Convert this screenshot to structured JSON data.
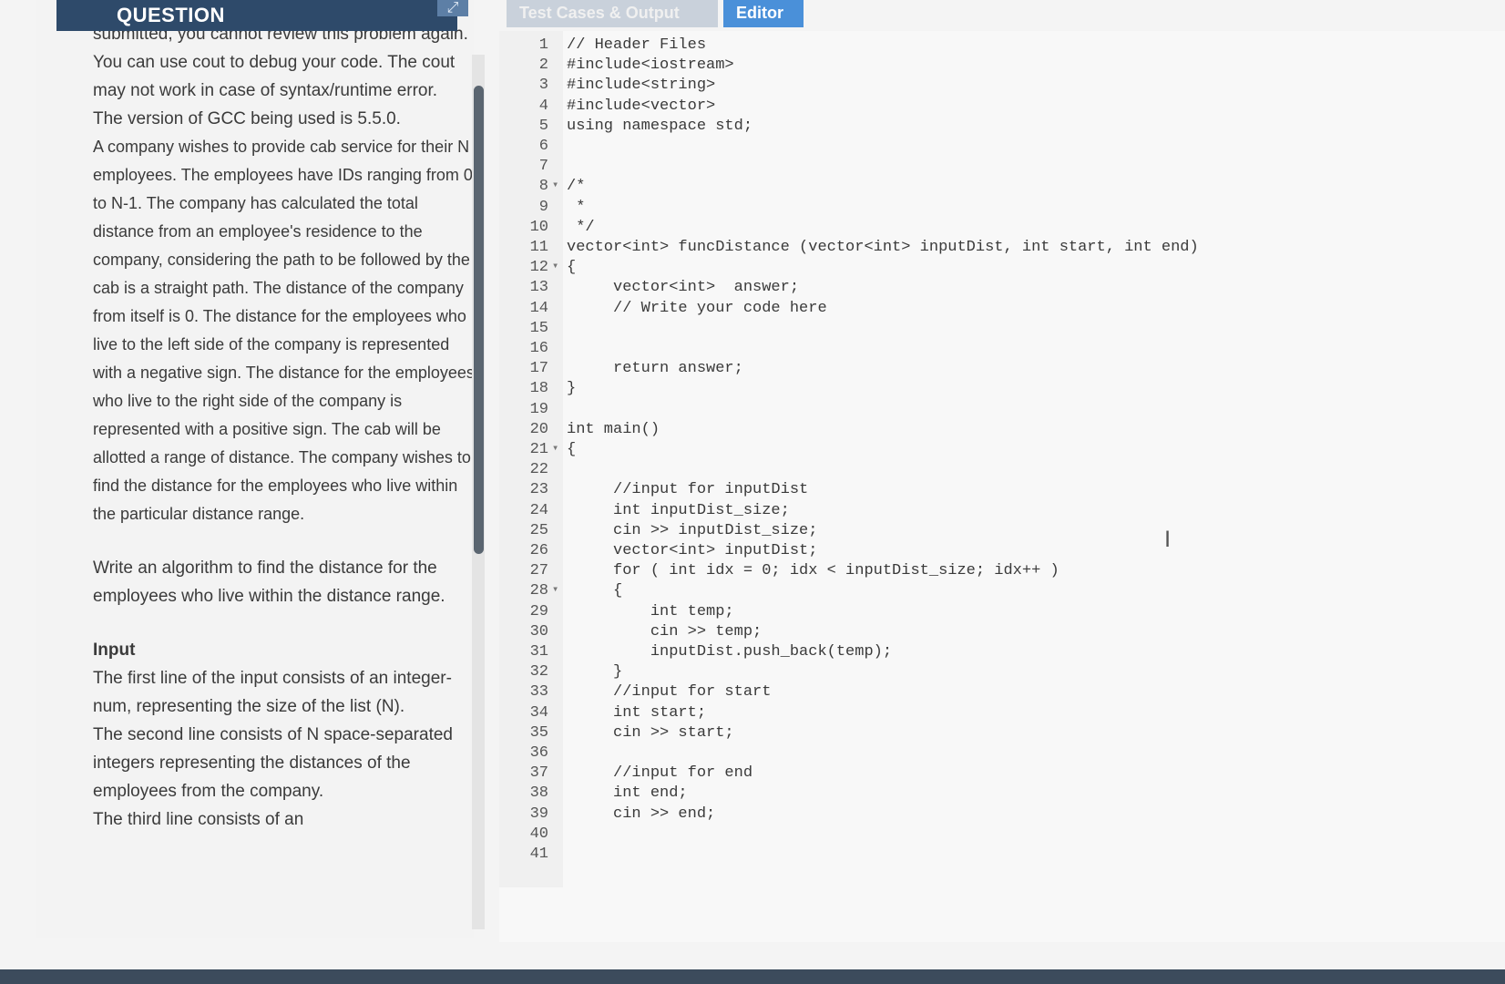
{
  "tabs": {
    "question": "QUESTION",
    "test_cases": "Test Cases & Output",
    "editor": "Editor"
  },
  "question": {
    "paragraphs": [
      "submitted, you cannot review this problem again. You can use cout to debug your code. The cout may not work in case of syntax/runtime error.",
      "The version of GCC being used is 5.5.0.",
      "A company wishes to provide cab service for their N employees. The employees have IDs ranging from 0 to N-1. The company has calculated the total distance from an employee's residence to the company, considering the path to be followed by the cab is a straight path. The distance of the company from itself is 0. The distance for the employees who live to the left side of the company is represented with a negative sign. The distance for the employees who live to the right side of the company is represented with a positive sign. The cab will be allotted a range of distance. The company wishes to find the distance for the employees who live within the particular distance range.",
      "Write an algorithm to find the distance for the employees who live within the distance range.",
      "Input",
      "The first line of the input consists of an integer- num, representing the size of the list (N).",
      "The second line consists of N space-separated integers representing the distances of the employees from the company.",
      "The third line consists of an"
    ]
  },
  "code_lines": [
    {
      "n": "1",
      "fold": "",
      "text": "// Header Files"
    },
    {
      "n": "2",
      "fold": "",
      "text": "#include<iostream>"
    },
    {
      "n": "3",
      "fold": "",
      "text": "#include<string>"
    },
    {
      "n": "4",
      "fold": "",
      "text": "#include<vector>"
    },
    {
      "n": "5",
      "fold": "",
      "text": "using namespace std;"
    },
    {
      "n": "6",
      "fold": "",
      "text": ""
    },
    {
      "n": "7",
      "fold": "",
      "text": ""
    },
    {
      "n": "8",
      "fold": "▾",
      "text": "/*"
    },
    {
      "n": "9",
      "fold": "",
      "text": " *"
    },
    {
      "n": "10",
      "fold": "",
      "text": " */"
    },
    {
      "n": "11",
      "fold": "",
      "text": "vector<int> funcDistance (vector<int> inputDist, int start, int end)"
    },
    {
      "n": "12",
      "fold": "▾",
      "text": "{"
    },
    {
      "n": "13",
      "fold": "",
      "text": "     vector<int>  answer;"
    },
    {
      "n": "14",
      "fold": "",
      "text": "     // Write your code here"
    },
    {
      "n": "15",
      "fold": "",
      "text": ""
    },
    {
      "n": "16",
      "fold": "",
      "text": ""
    },
    {
      "n": "17",
      "fold": "",
      "text": "     return answer;"
    },
    {
      "n": "18",
      "fold": "",
      "text": "}"
    },
    {
      "n": "19",
      "fold": "",
      "text": ""
    },
    {
      "n": "20",
      "fold": "",
      "text": "int main()"
    },
    {
      "n": "21",
      "fold": "▾",
      "text": "{"
    },
    {
      "n": "22",
      "fold": "",
      "text": ""
    },
    {
      "n": "23",
      "fold": "",
      "text": "     //input for inputDist"
    },
    {
      "n": "24",
      "fold": "",
      "text": "     int inputDist_size;"
    },
    {
      "n": "25",
      "fold": "",
      "text": "     cin >> inputDist_size;"
    },
    {
      "n": "26",
      "fold": "",
      "text": "     vector<int> inputDist;"
    },
    {
      "n": "27",
      "fold": "",
      "text": "     for ( int idx = 0; idx < inputDist_size; idx++ )"
    },
    {
      "n": "28",
      "fold": "▾",
      "text": "     {"
    },
    {
      "n": "29",
      "fold": "",
      "text": "         int temp;"
    },
    {
      "n": "30",
      "fold": "",
      "text": "         cin >> temp;"
    },
    {
      "n": "31",
      "fold": "",
      "text": "         inputDist.push_back(temp);"
    },
    {
      "n": "32",
      "fold": "",
      "text": "     }"
    },
    {
      "n": "33",
      "fold": "",
      "text": "     //input for start"
    },
    {
      "n": "34",
      "fold": "",
      "text": "     int start;"
    },
    {
      "n": "35",
      "fold": "",
      "text": "     cin >> start;"
    },
    {
      "n": "36",
      "fold": "",
      "text": ""
    },
    {
      "n": "37",
      "fold": "",
      "text": "     //input for end"
    },
    {
      "n": "38",
      "fold": "",
      "text": "     int end;"
    },
    {
      "n": "39",
      "fold": "",
      "text": "     cin >> end;"
    },
    {
      "n": "40",
      "fold": "",
      "text": ""
    },
    {
      "n": "41",
      "fold": "",
      "text": ""
    }
  ]
}
